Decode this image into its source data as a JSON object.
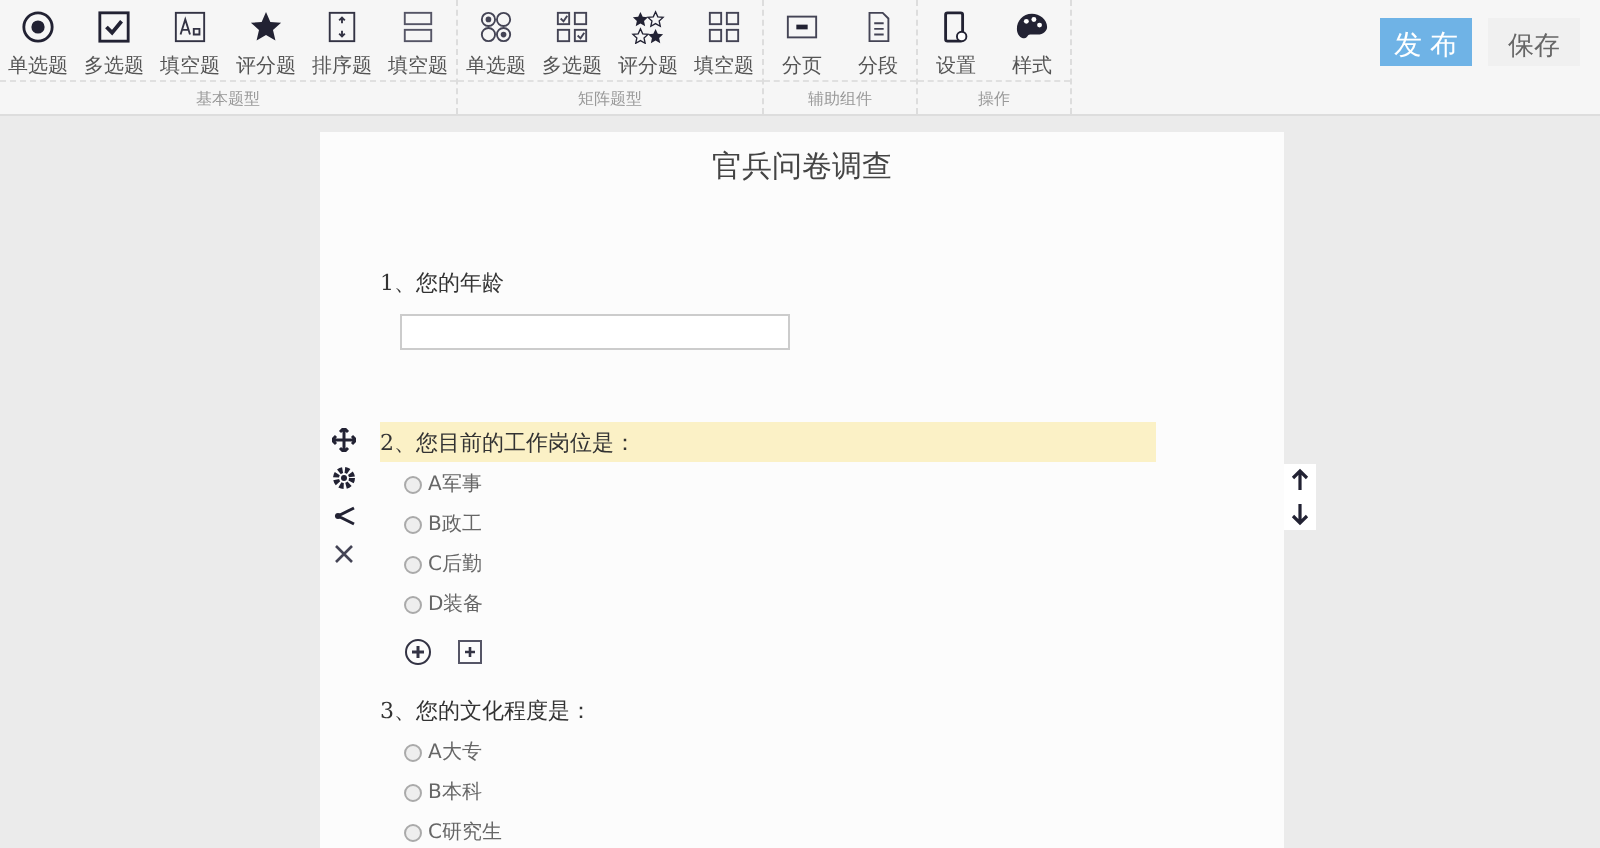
{
  "toolbar": {
    "groups": [
      {
        "label": "基本题型",
        "tools": [
          {
            "label": "单选题",
            "kind": "radio"
          },
          {
            "label": "多选题",
            "kind": "check"
          },
          {
            "label": "填空题",
            "kind": "text"
          },
          {
            "label": "评分题",
            "kind": "star"
          },
          {
            "label": "排序题",
            "kind": "sort"
          },
          {
            "label": "填空题",
            "kind": "multitext"
          }
        ]
      },
      {
        "label": "矩阵题型",
        "tools": [
          {
            "label": "单选题",
            "kind": "mradio"
          },
          {
            "label": "多选题",
            "kind": "mcheck"
          },
          {
            "label": "评分题",
            "kind": "mstar"
          },
          {
            "label": "填空题",
            "kind": "mtext"
          }
        ]
      },
      {
        "label": "辅助组件",
        "tools": [
          {
            "label": "分页",
            "kind": "page"
          },
          {
            "label": "分段",
            "kind": "section"
          }
        ]
      },
      {
        "label": "操作",
        "tools": [
          {
            "label": "设置",
            "kind": "settings"
          },
          {
            "label": "样式",
            "kind": "palette"
          }
        ]
      }
    ],
    "publish": "发 布",
    "save": "保存"
  },
  "survey": {
    "title": "官兵问卷调查",
    "questions": [
      {
        "number": "1、",
        "text": "您的年龄",
        "kind": "text",
        "selected": false
      },
      {
        "number": "2、",
        "text": "您目前的工作岗位是：",
        "kind": "choice",
        "selected": true,
        "options": [
          {
            "label": "A军事",
            "selected": false
          },
          {
            "label": "B政工",
            "selected": false
          },
          {
            "label": "C后勤",
            "selected": false
          },
          {
            "label": "D装备",
            "selected": false
          }
        ]
      },
      {
        "number": "3、",
        "text": "您的文化程度是：",
        "kind": "choice",
        "selected": false,
        "options": [
          {
            "label": "A大专",
            "selected": false
          },
          {
            "label": "B本科",
            "selected": false
          },
          {
            "label": "C研究生",
            "selected": false
          }
        ]
      }
    ]
  }
}
